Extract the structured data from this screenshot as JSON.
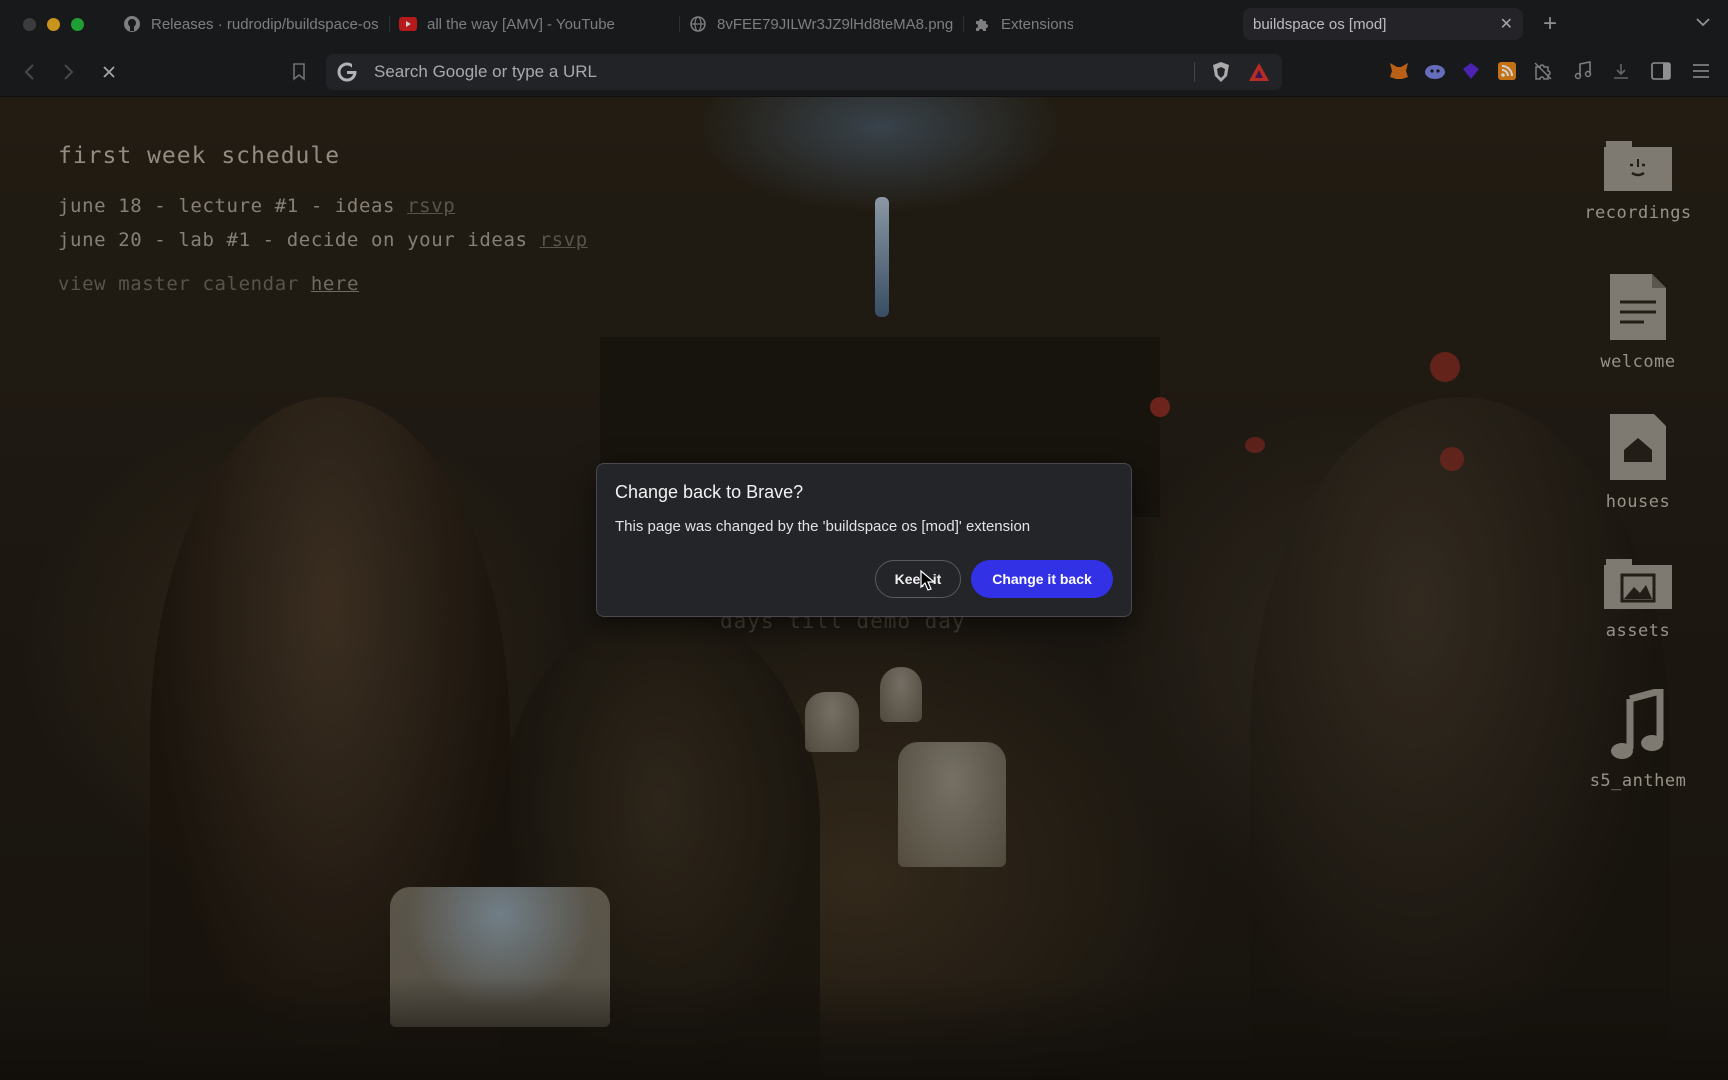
{
  "window": {
    "traffic_lights": [
      "close",
      "minimize",
      "maximize"
    ]
  },
  "tabs": [
    {
      "title": "Releases · rudrodip/buildspace-os",
      "icon": "github-icon",
      "active": false
    },
    {
      "title": "all the way [AMV] - YouTube",
      "icon": "youtube-icon",
      "active": false
    },
    {
      "title": "8vFEE79JILWr3JZ9lHd8teMA8.png",
      "icon": "globe-icon",
      "active": false
    },
    {
      "title": "Extensions",
      "icon": "puzzle-icon",
      "active": false
    },
    {
      "title": "buildspace os [mod]",
      "icon": "",
      "active": true
    }
  ],
  "toolbar": {
    "omnibox_placeholder": "Search Google or type a URL"
  },
  "page": {
    "schedule_title": "first week schedule",
    "events": [
      {
        "text": "june 18 - lecture #1 - ideas",
        "link": "rsvp"
      },
      {
        "text": "june 20 - lab #1 - decide on your ideas",
        "link": "rsvp"
      }
    ],
    "calendar_text": "view master calendar",
    "calendar_link": "here",
    "countdown_text": "days till demo day",
    "desktop_icons": [
      {
        "label": "recordings",
        "icon": "folder-icon"
      },
      {
        "label": "welcome",
        "icon": "document-icon"
      },
      {
        "label": "houses",
        "icon": "house-file-icon"
      },
      {
        "label": "assets",
        "icon": "image-folder-icon"
      },
      {
        "label": "s5_anthem",
        "icon": "music-note-icon"
      }
    ]
  },
  "dialog": {
    "title": "Change back to Brave?",
    "message": "This page was changed by the 'buildspace os [mod]' extension",
    "keep_label": "Keep it",
    "change_label": "Change it back"
  },
  "colors": {
    "accent": "#3231e6",
    "chrome_bg": "#1e1f22"
  }
}
